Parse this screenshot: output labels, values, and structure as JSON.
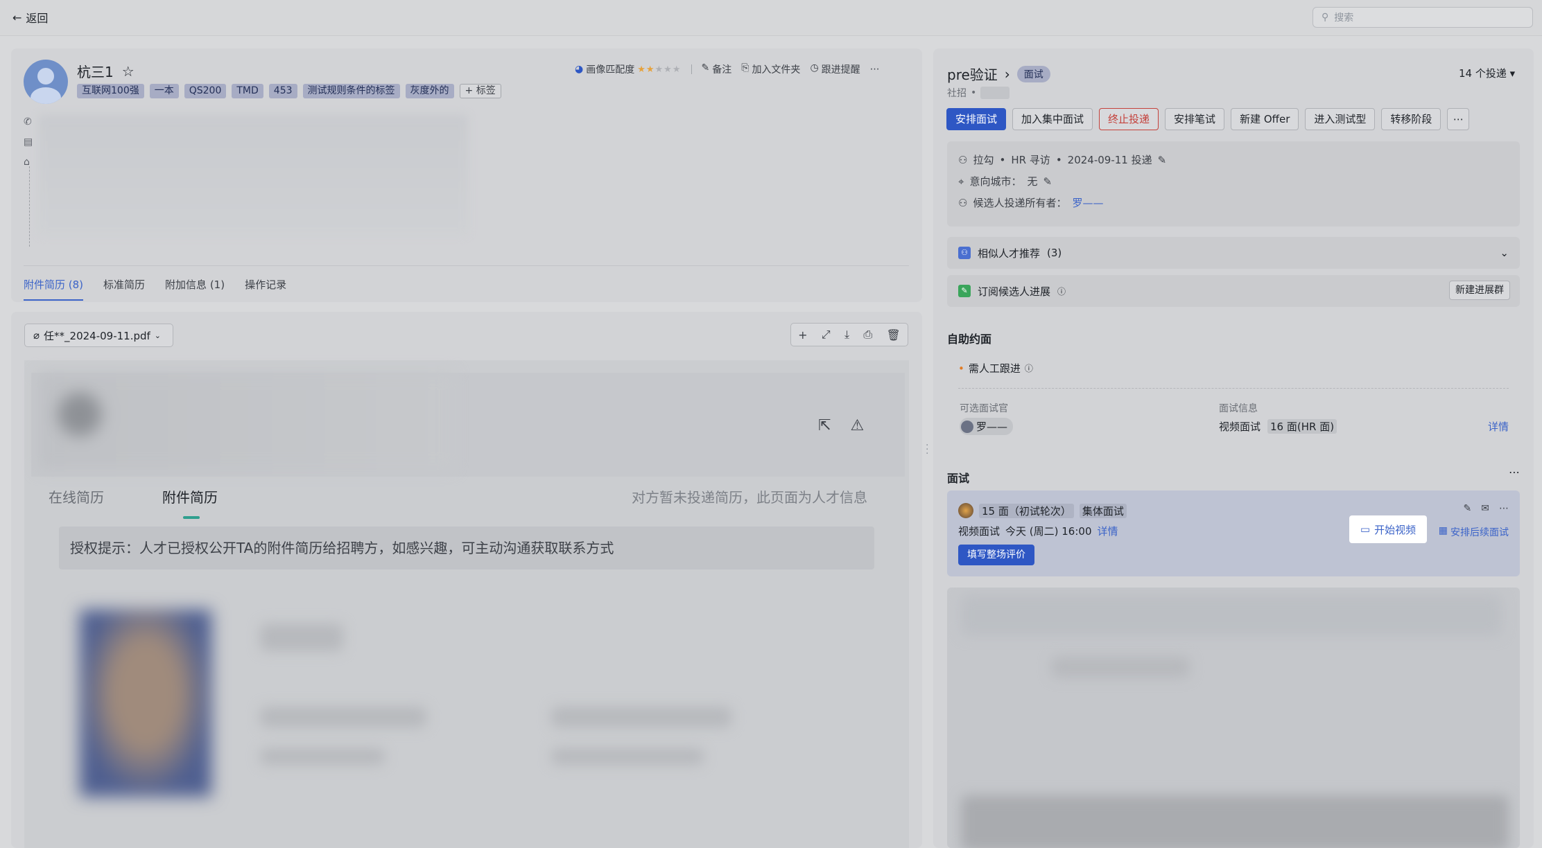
{
  "topbar": {
    "back_label": "返回",
    "search_placeholder": "搜索"
  },
  "candidate": {
    "name": "杭三1",
    "tags": [
      "互联网100强",
      "一本",
      "QS200",
      "TMD",
      "453",
      "测试规则条件的标签",
      "灰度外的"
    ],
    "add_tag_label": "+ 标签",
    "match_label": "画像匹配度",
    "match_rating": 2,
    "match_rating_max": 5,
    "note_label": "备注",
    "folder_label": "加入文件夹",
    "reminder_label": "跟进提醒"
  },
  "left_tabs": [
    {
      "label": "附件简历 (8)",
      "active": true
    },
    {
      "label": "标准简历",
      "active": false
    },
    {
      "label": "附加信息 (1)",
      "active": false
    },
    {
      "label": "操作记录",
      "active": false
    }
  ],
  "file": {
    "name": "任**_2024-09-11.pdf"
  },
  "viewer": {
    "tabs": [
      {
        "label": "在线简历",
        "active": false
      },
      {
        "label": "附件简历",
        "active": true
      }
    ],
    "notice": "对方暂未投递简历，此页面为人才信息",
    "auth_tip": "授权提示：人才已授权公开TA的附件简历给招聘方，如感兴趣，可主动沟通获取联系方式"
  },
  "job": {
    "title": "pre验证",
    "stage": "面试",
    "deliveries": "14 个投递",
    "type": "社招"
  },
  "actions": {
    "schedule": "安排面试",
    "group": "加入集中面试",
    "terminate": "终止投递",
    "written": "安排笔试",
    "offer": "新建 Offer",
    "test": "进入测试型",
    "transfer": "转移阶段"
  },
  "info": {
    "source": "拉勾",
    "channel": "HR 寻访",
    "date": "2024-09-11 投递",
    "city_label": "意向城市：",
    "city": "无",
    "owner_label": "候选人投递所有者：",
    "owner": "罗——"
  },
  "similar": {
    "label": "相似人才推荐",
    "count": "(3)"
  },
  "subscribe": {
    "label": "订阅候选人进展",
    "button": "新建进展群"
  },
  "self_schedule": {
    "title": "自助约面",
    "status": "需人工跟进",
    "interviewer_label": "可选面试官",
    "interviewer": "罗——",
    "info_label": "面试信息",
    "info_type": "视频面试",
    "info_round": "16 面(HR 面)",
    "detail": "详情"
  },
  "interview": {
    "title": "面试",
    "round": "15 面（初试轮次）",
    "kind": "集体面试",
    "mode": "视频面试",
    "time": "今天 (周二) 16:00",
    "detail": "详情",
    "fill_eval": "填写整场评价",
    "start_video": "开始视频",
    "schedule_next": "安排后续面试"
  },
  "colors": {
    "primary": "#2e57c4",
    "danger": "#c4413b",
    "link": "#3b63c8",
    "tag_bg": "#a7acc4"
  }
}
